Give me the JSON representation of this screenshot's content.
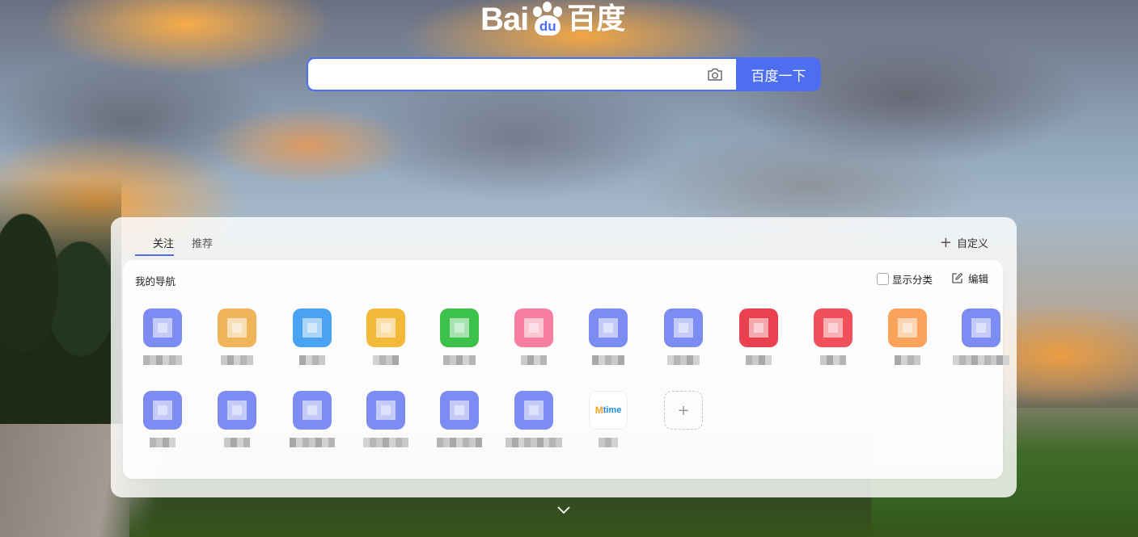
{
  "logo": {
    "text_en": "Bai",
    "paw_text": "du",
    "text_cn": "百度"
  },
  "search": {
    "value": "",
    "placeholder": "",
    "button_label": "百度一下"
  },
  "tabs": [
    {
      "label": "关注",
      "active": true
    },
    {
      "label": "推荐",
      "active": false
    }
  ],
  "customize_label": "自定义",
  "nav": {
    "title": "我的导航",
    "show_categories_label": "显示分类",
    "edit_label": "编辑",
    "tiles": [
      {
        "color": "#7d8cf2",
        "label_widths": 6
      },
      {
        "color": "#f0b55a",
        "label_widths": 5
      },
      {
        "color": "#4aa3f2",
        "label_widths": 4
      },
      {
        "color": "#f5b93a",
        "label_widths": 4
      },
      {
        "color": "#3cc24a",
        "label_widths": 5
      },
      {
        "color": "#f77ea0",
        "label_widths": 4
      },
      {
        "color": "#7d8cf2",
        "label_widths": 5
      },
      {
        "color": "#7d8cf2",
        "label_widths": 5
      },
      {
        "color": "#e9424e",
        "label_widths": 4
      },
      {
        "color": "#f0505a",
        "label_widths": 4
      },
      {
        "color": "#f9a35a",
        "label_widths": 4
      },
      {
        "color": "#7d8cf2",
        "label_widths": 9
      },
      {
        "color": "#7d8cf2",
        "label_widths": 4
      },
      {
        "color": "#7d8cf2",
        "label_widths": 4
      },
      {
        "color": "#7d8cf2",
        "label_widths": 7
      },
      {
        "color": "#7d8cf2",
        "label_widths": 7
      },
      {
        "color": "#7d8cf2",
        "label_widths": 7
      },
      {
        "color": "#7d8cf2",
        "label_widths": 9
      }
    ],
    "mtime_tile": {
      "m": "M",
      "rest": "time"
    },
    "add_symbol": "+"
  },
  "icons": {
    "camera": "camera-icon",
    "plus": "plus-icon",
    "edit": "edit-icon",
    "chevron": "chevron-down-icon"
  },
  "colors": {
    "accent": "#4e6ef2"
  }
}
